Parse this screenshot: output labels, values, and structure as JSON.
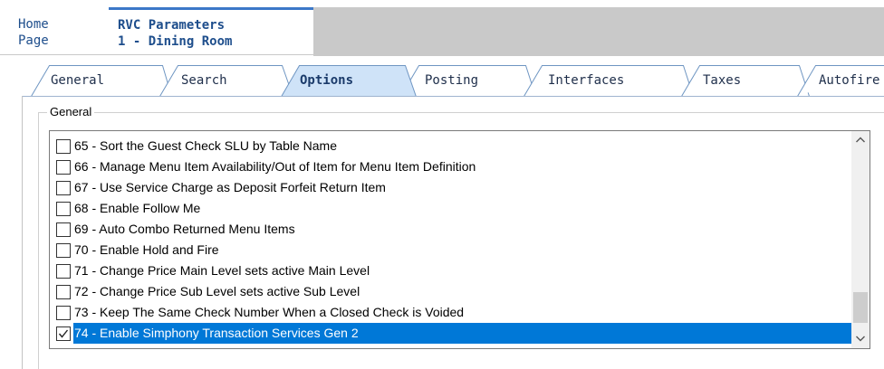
{
  "doc_tabs": {
    "home": {
      "line1": "Home",
      "line2": "Page"
    },
    "active": {
      "line1": "RVC Parameters",
      "line2": "1 - Dining Room"
    }
  },
  "property_tabs": [
    {
      "label": "General",
      "active": false
    },
    {
      "label": "Search",
      "active": false
    },
    {
      "label": "Options",
      "active": true
    },
    {
      "label": "Posting",
      "active": false
    },
    {
      "label": "Interfaces",
      "active": false
    },
    {
      "label": "Taxes",
      "active": false
    },
    {
      "label": "Autofire",
      "active": false
    }
  ],
  "group": {
    "title": "General",
    "items": [
      {
        "label": "65 - Sort the Guest Check SLU by Table Name",
        "checked": false,
        "selected": false
      },
      {
        "label": "66 - Manage Menu Item Availability/Out of Item for Menu Item Definition",
        "checked": false,
        "selected": false
      },
      {
        "label": "67 - Use Service Charge as Deposit Forfeit Return Item",
        "checked": false,
        "selected": false
      },
      {
        "label": "68 - Enable Follow Me",
        "checked": false,
        "selected": false
      },
      {
        "label": "69 - Auto Combo Returned Menu Items",
        "checked": false,
        "selected": false
      },
      {
        "label": "70 - Enable Hold and Fire",
        "checked": false,
        "selected": false
      },
      {
        "label": "71 - Change Price Main Level sets active Main Level",
        "checked": false,
        "selected": false
      },
      {
        "label": "72 - Change Price Sub Level sets active Sub Level",
        "checked": false,
        "selected": false
      },
      {
        "label": "73 - Keep The Same Check Number When a Closed Check is Voided",
        "checked": false,
        "selected": false
      },
      {
        "label": "74 - Enable Simphony Transaction Services Gen 2",
        "checked": true,
        "selected": true
      }
    ]
  },
  "colors": {
    "selection": "#0078d7",
    "tab_active_fill": "#cfe3f8",
    "tab_border": "#6e95c2"
  }
}
